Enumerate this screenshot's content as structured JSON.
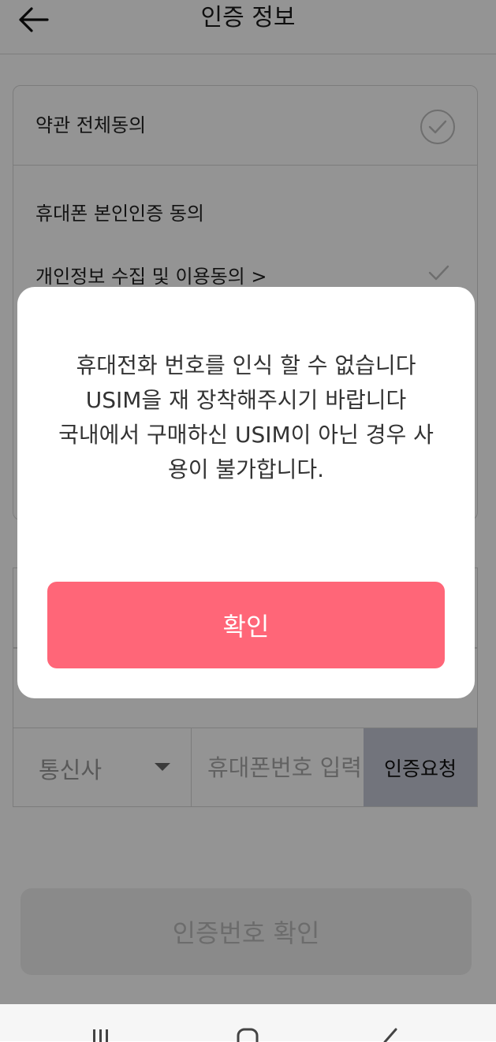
{
  "header": {
    "title": "인증 정보",
    "back_icon": "arrow-left-icon"
  },
  "terms": {
    "all_label": "약관 전체동의",
    "items": [
      {
        "label": "휴대폰 본인인증 동의"
      },
      {
        "label": "개인정보 수집 및 이용동의 >"
      }
    ]
  },
  "phone": {
    "carrier_label": "통신사",
    "input_placeholder": "휴대폰번호 입력",
    "request_label": "인증요청"
  },
  "verify": {
    "confirm_label": "인증번호 확인"
  },
  "dialog": {
    "message": "휴대전화 번호를 인식 할 수 없습니다\nUSIM을 재 장착해주시기 바랍니다\n국내에서 구매하신 USIM이 아닌 경우 사용이 불가합니다.",
    "ok_label": "확인"
  },
  "colors": {
    "accent": "#ff6678",
    "request_bg": "#c4c9d6"
  }
}
